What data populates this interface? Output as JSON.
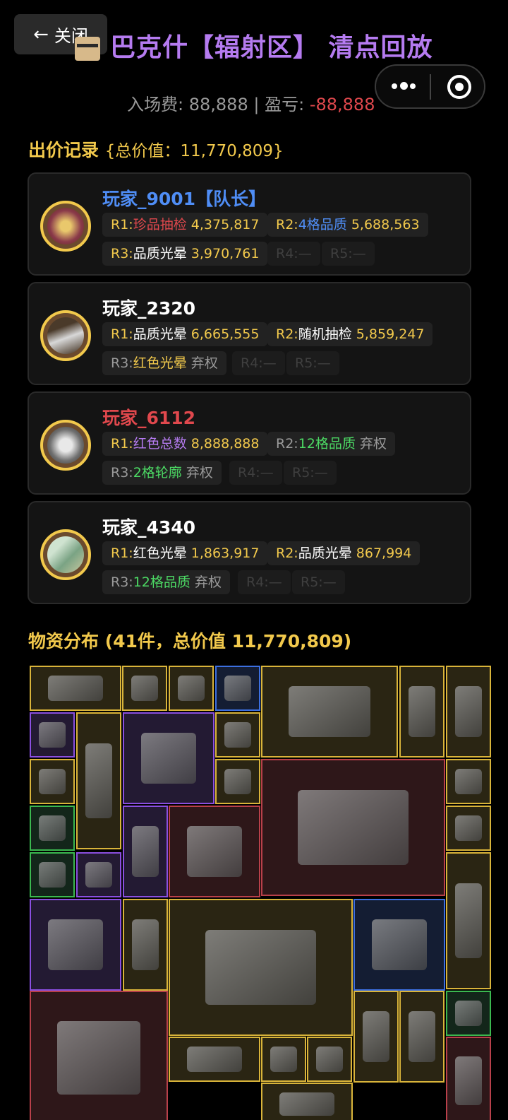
{
  "nav": {
    "close_label": "关闭"
  },
  "header": {
    "title": "巴克什【辐射区】 清点回放",
    "entry_label": "入场费:",
    "entry_fee": "88,888",
    "separator": "|",
    "pnl_label": "盈亏:",
    "pnl_value": "-88,888"
  },
  "bids_section": {
    "title": "出价记录",
    "total_label": "{总价值：11,770,809}"
  },
  "players": [
    {
      "name": "玩家_9001【队长】",
      "rounds": [
        {
          "round": "R1:",
          "item": "珍品抽检",
          "value": "4,375,817"
        },
        {
          "round": "R2:",
          "item": "4格品质",
          "value": "5,688,563"
        },
        {
          "round": "R3:",
          "item": "品质光晕",
          "value": "3,970,761"
        },
        {
          "round": "R4:",
          "item": "",
          "value": "—"
        },
        {
          "round": "R5:",
          "item": "",
          "value": "—"
        }
      ]
    },
    {
      "name": "玩家_2320",
      "rounds": [
        {
          "round": "R1:",
          "item": "品质光晕",
          "value": "6,665,555"
        },
        {
          "round": "R2:",
          "item": "随机抽检",
          "value": "5,859,247"
        },
        {
          "round": "R3:",
          "item": "红色光晕",
          "value": "弃权"
        },
        {
          "round": "R4:",
          "item": "",
          "value": "—"
        },
        {
          "round": "R5:",
          "item": "",
          "value": "—"
        }
      ]
    },
    {
      "name": "玩家_6112",
      "rounds": [
        {
          "round": "R1:",
          "item": "红色总数",
          "value": "8,888,888"
        },
        {
          "round": "R2:",
          "item": "12格品质",
          "value": "弃权"
        },
        {
          "round": "R3:",
          "item": "2格轮廓",
          "value": "弃权"
        },
        {
          "round": "R4:",
          "item": "",
          "value": "—"
        },
        {
          "round": "R5:",
          "item": "",
          "value": "—"
        }
      ]
    },
    {
      "name": "玩家_4340",
      "rounds": [
        {
          "round": "R1:",
          "item": "红色光晕",
          "value": "1,863,917"
        },
        {
          "round": "R2:",
          "item": "品质光晕",
          "value": "867,994"
        },
        {
          "round": "R3:",
          "item": "12格品质",
          "value": "弃权"
        },
        {
          "round": "R4:",
          "item": "",
          "value": "—"
        },
        {
          "round": "R5:",
          "item": "",
          "value": "—"
        }
      ]
    }
  ],
  "items_section": {
    "title": "物资分布 (41件，总价值 11,770,809)"
  },
  "colors": {
    "gold": "#f2c94c",
    "purple": "#b57bf0",
    "blue": "#4f8df5",
    "red": "#e0484d",
    "green": "#4cd964",
    "rarity_gold": "#d9b43a",
    "rarity_purple": "#8a4fe0",
    "rarity_blue": "#3c6fe0",
    "rarity_red": "#b8404a",
    "rarity_green": "#3bb84f"
  },
  "grid_items": [
    {
      "name": "aviator-sunglasses-icon",
      "rarity": "gold"
    },
    {
      "name": "gear-box-icon",
      "rarity": "gold"
    },
    {
      "name": "cigarette-pack-icon",
      "rarity": "gold"
    },
    {
      "name": "matchbox-icon",
      "rarity": "blue"
    },
    {
      "name": "jeweled-pendant-icon",
      "rarity": "gold"
    },
    {
      "name": "book-icon",
      "rarity": "gold"
    },
    {
      "name": "photo-icon",
      "rarity": "gold"
    },
    {
      "name": "gpu-bracket-icon",
      "rarity": "purple"
    },
    {
      "name": "tube-canister-icon",
      "rarity": "gold"
    },
    {
      "name": "coffee-machine-icon",
      "rarity": "purple"
    },
    {
      "name": "pacemaker-icon",
      "rarity": "gold"
    },
    {
      "name": "pacemaker-icon",
      "rarity": "gold"
    },
    {
      "name": "usb-drive-icon",
      "rarity": "gold"
    },
    {
      "name": "server-rack-icon",
      "rarity": "red"
    },
    {
      "name": "lighter-icon",
      "rarity": "gold"
    },
    {
      "name": "pen-icon",
      "rarity": "green"
    },
    {
      "name": "blowtorch-icon",
      "rarity": "purple"
    },
    {
      "name": "golden-statue-icon",
      "rarity": "red"
    },
    {
      "name": "usb-drive-icon",
      "rarity": "gold"
    },
    {
      "name": "syringe-icon",
      "rarity": "green"
    },
    {
      "name": "ring-icon",
      "rarity": "purple"
    },
    {
      "name": "tube-canister-icon",
      "rarity": "gold"
    },
    {
      "name": "motherboard-icon",
      "rarity": "purple"
    },
    {
      "name": "figurine-icon",
      "rarity": "gold"
    },
    {
      "name": "server-motherboard-icon",
      "rarity": "gold"
    },
    {
      "name": "gas-tank-icon",
      "rarity": "blue"
    },
    {
      "name": "vial-icon",
      "rarity": "green"
    },
    {
      "name": "tank-model-icon",
      "rarity": "red"
    },
    {
      "name": "coffee-bag-icon",
      "rarity": "gold"
    },
    {
      "name": "coffee-bag-icon",
      "rarity": "gold"
    },
    {
      "name": "aviator-sunglasses-icon",
      "rarity": "gold"
    },
    {
      "name": "necklace-icon",
      "rarity": "gold"
    },
    {
      "name": "cube-icon",
      "rarity": "gold"
    },
    {
      "name": "photo-icon",
      "rarity": "red"
    },
    {
      "name": "crown-icon",
      "rarity": "gold"
    }
  ]
}
